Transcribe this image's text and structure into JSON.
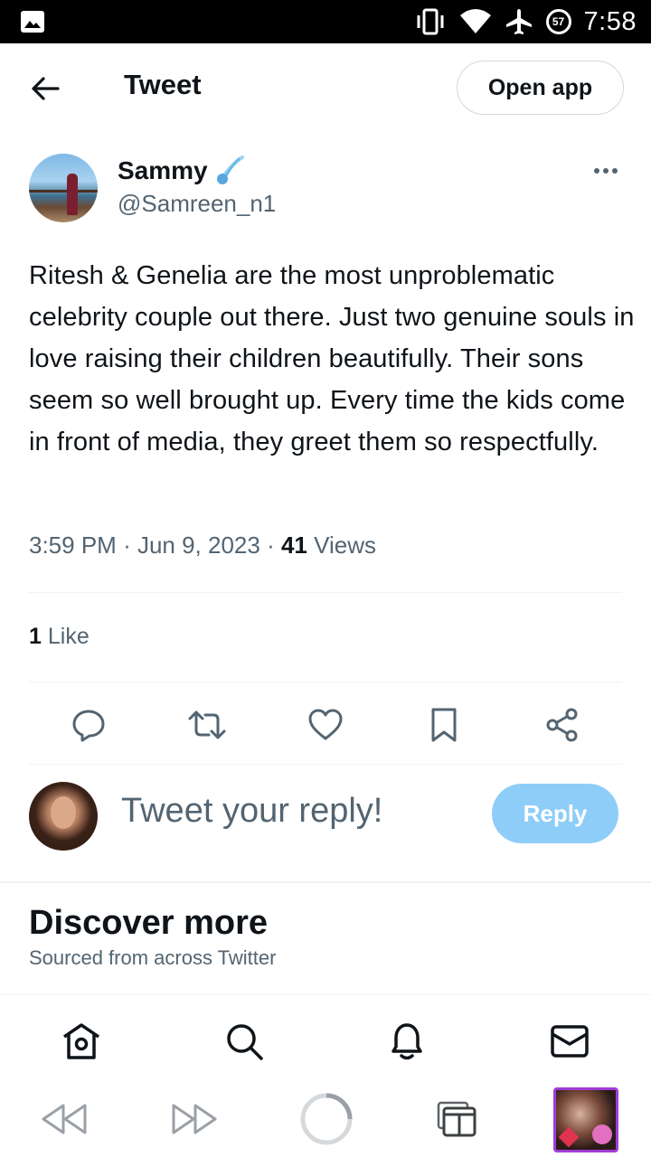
{
  "status_bar": {
    "time": "7:58",
    "battery": "57"
  },
  "header": {
    "title": "Tweet",
    "open_app_label": "Open app"
  },
  "author": {
    "name": "Sammy",
    "handle": "@Samreen_n1"
  },
  "tweet": {
    "text": "Ritesh & Genelia are the most unproblematic celebrity couple out there. Just two genuine souls in love raising their children beautifully. Their sons seem so well brought up. Every time the kids come in front of media, they greet them so respectfully.",
    "time": "3:59 PM",
    "date": "Jun 9, 2023",
    "views_count": "41",
    "views_label": "Views",
    "likes_count": "1",
    "likes_label": "Like"
  },
  "actions": [
    "reply-icon",
    "retweet-icon",
    "like-icon",
    "bookmark-icon",
    "share-icon"
  ],
  "reply": {
    "placeholder": "Tweet your reply!",
    "button_label": "Reply"
  },
  "discover": {
    "title": "Discover more",
    "subtitle": "Sourced from across Twitter"
  },
  "bottom_nav": [
    "home-icon",
    "search-icon",
    "notifications-icon",
    "messages-icon"
  ],
  "browser_bar": [
    "rewind-icon",
    "fast-forward-icon",
    "reload-icon",
    "tabs-icon",
    "tab-thumbnail"
  ],
  "colors": {
    "reply_button": "#8ecdf8",
    "secondary_text": "#536471",
    "primary_text": "#0f1419",
    "tab_border": "#a23cd6"
  }
}
